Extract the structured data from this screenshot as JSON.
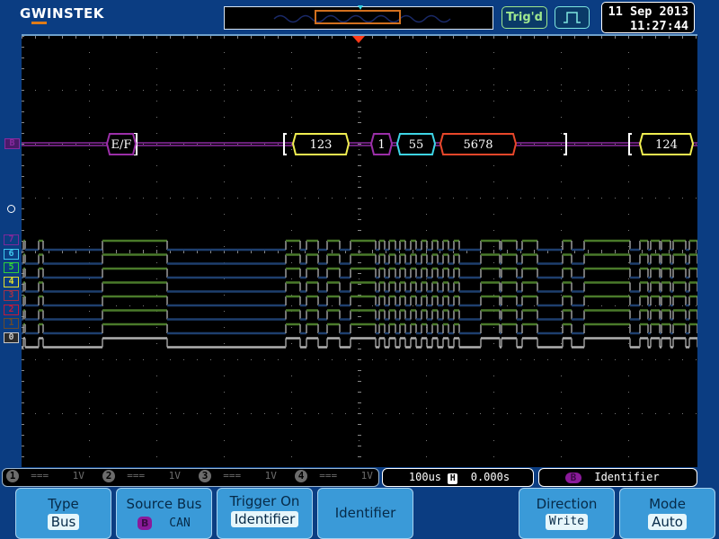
{
  "brand": {
    "name_prefix": "G",
    "name_w": "W",
    "name_suffix": "INSTEK"
  },
  "header": {
    "trigger_status": "Trig'd",
    "trigger_icon": "rising-pulse-icon",
    "date": "11 Sep 2013",
    "time": "11:27:44"
  },
  "bus": {
    "label": "B",
    "color": "#8a1a9a",
    "packets": [
      {
        "text": "E/F",
        "color": "#9b2fa8"
      },
      {
        "text": "123",
        "color": "#f0ee50"
      },
      {
        "text": "1",
        "color": "#9b2fa8"
      },
      {
        "text": "55",
        "color": "#3ed5e6"
      },
      {
        "text": "5678",
        "color": "#e8472a"
      },
      {
        "text": "124",
        "color": "#f0ee50"
      }
    ]
  },
  "digital_channels": [
    {
      "label": "7",
      "color": "#7a2a9a"
    },
    {
      "label": "6",
      "color": "#3fc8ef"
    },
    {
      "label": "5",
      "color": "#2fcf3a"
    },
    {
      "label": "4",
      "color": "#e2de2a"
    },
    {
      "label": "3",
      "color": "#a0324a"
    },
    {
      "label": "2",
      "color": "#c21a3a"
    },
    {
      "label": "1",
      "color": "#6a4a2a"
    },
    {
      "label": "0",
      "color": "#c8c8c8"
    }
  ],
  "analog_channels": [
    {
      "number": "1",
      "coupling": "===",
      "scale": "1V"
    },
    {
      "number": "2",
      "coupling": "===",
      "scale": "1V"
    },
    {
      "number": "3",
      "coupling": "===",
      "scale": "1V"
    },
    {
      "number": "4",
      "coupling": "===",
      "scale": "1V"
    }
  ],
  "timebase": {
    "scale": "100us",
    "mode_icon": "H",
    "position": "0.000s"
  },
  "trigger_info": {
    "source": "B",
    "type": "Identifier"
  },
  "softkeys": [
    {
      "title": "Type",
      "value": "Bus"
    },
    {
      "title": "Source Bus",
      "badge": "B",
      "value": "CAN"
    },
    {
      "title": "Trigger On",
      "value": "Identifier"
    },
    {
      "title": "Identifier"
    },
    {
      "title": "Direction",
      "value": "Write"
    },
    {
      "title": "Mode",
      "value": "Auto"
    }
  ]
}
